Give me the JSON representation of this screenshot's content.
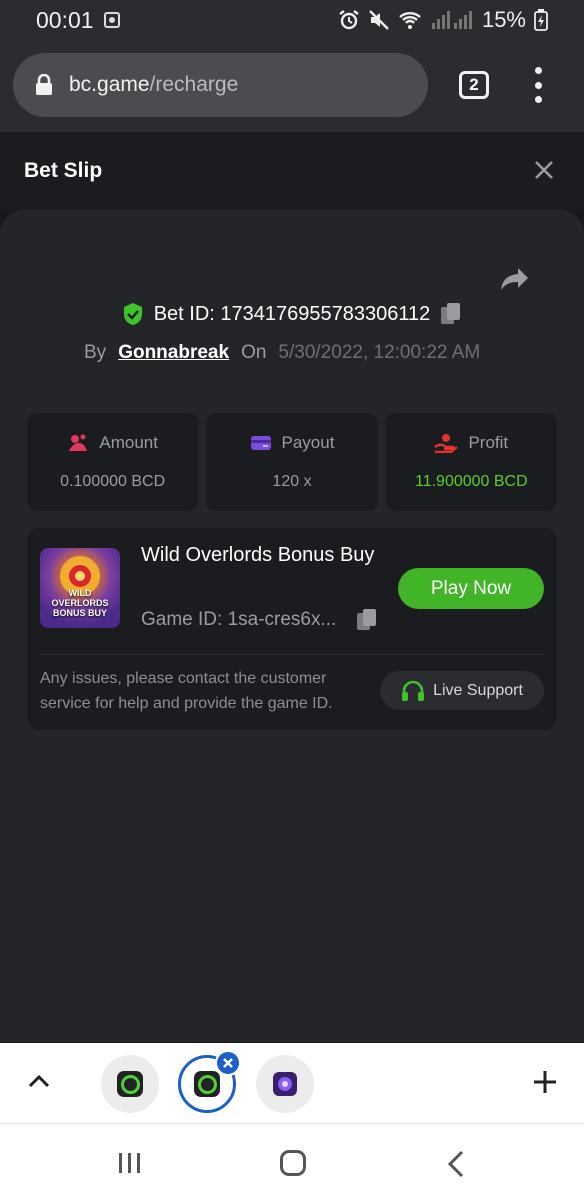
{
  "status_bar": {
    "time": "00:01",
    "battery": "15%"
  },
  "browser": {
    "url_host": "bc.game",
    "url_path": "/recharge",
    "tab_count": "2"
  },
  "bet_slip": {
    "title": "Bet Slip",
    "bet_id_label": "Bet ID: 1734176955783306112",
    "by_label": "By",
    "username": "Gonnabreak",
    "on_label": "On",
    "date": "5/30/2022, 12:00:22 AM",
    "stats": [
      {
        "label": "Amount",
        "value": "0.100000 BCD"
      },
      {
        "label": "Payout",
        "value": "120 x"
      },
      {
        "label": "Profit",
        "value": "11.900000 BCD"
      }
    ],
    "game": {
      "name": "Wild Overlords Bonus Buy",
      "thumb_text": "WILD OVERLORDS BONUS BUY",
      "game_id": "Game ID: 1sa-cres6x...",
      "play_label": "Play Now",
      "issue_text": "Any issues, please contact the customer service for help and provide the game ID.",
      "live_support_label": "Live Support"
    }
  },
  "colors": {
    "accent_green": "#41b427",
    "profit_green": "#5ccd2b",
    "tab_blue": "#1b5fc7"
  }
}
